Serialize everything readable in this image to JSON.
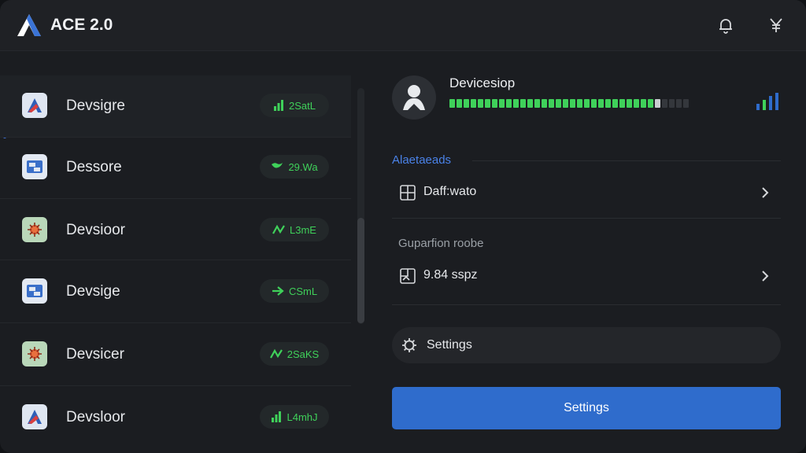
{
  "app": {
    "title": "ACE 2.0"
  },
  "titlebar": {
    "icons": [
      "bell-icon",
      "yen-icon"
    ]
  },
  "devices": [
    {
      "name": "Devsigre",
      "badge": "2SatL",
      "badge_icon": "signal-bars-icon",
      "icon": "logo-tile-icon",
      "active": true
    },
    {
      "name": "Dessore",
      "badge": "29.Wa",
      "badge_icon": "bird-icon",
      "icon": "chip-card-icon",
      "active": false
    },
    {
      "name": "Devsioor",
      "badge": "L3mE",
      "badge_icon": "trend-icon",
      "icon": "bug-icon",
      "active": false
    },
    {
      "name": "Devsige",
      "badge": "CSmL",
      "badge_icon": "arrow-right-icon",
      "icon": "chip-card-icon",
      "active": false
    },
    {
      "name": "Devsicer",
      "badge": "2SaKS",
      "badge_icon": "trend-icon",
      "icon": "bug-icon",
      "active": false
    },
    {
      "name": "Devsloor",
      "badge": "L4mhJ",
      "badge_icon": "signal-bars-icon",
      "icon": "logo-tile-icon",
      "active": false
    }
  ],
  "detail": {
    "device_title": "Devicesiop",
    "progress": {
      "segments_total": 34,
      "filled": 29
    },
    "section1": {
      "label": "Alaetaeads",
      "item": "Daff:wato"
    },
    "section2": {
      "label": "Guparfion roobe",
      "item": "9.84 sspz"
    },
    "settings_row": "Settings",
    "primary_button": "Settings"
  },
  "colors": {
    "accent": "#2f6ccc",
    "success": "#3fd15a",
    "background": "#1b1d21"
  }
}
